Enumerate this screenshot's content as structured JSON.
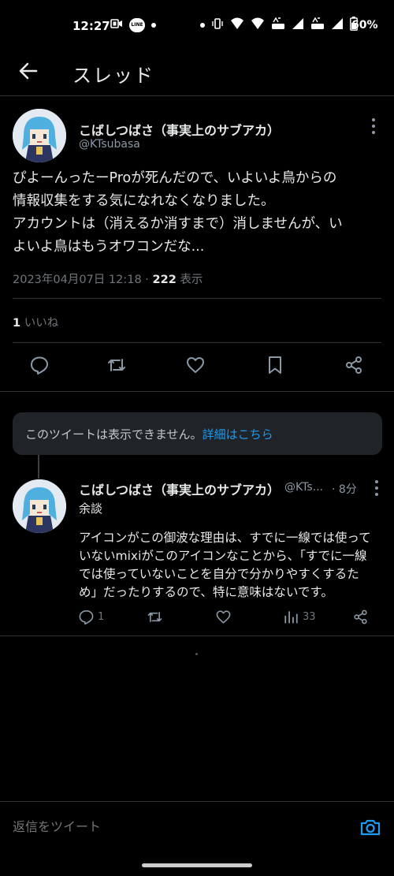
{
  "status_bar": {
    "time": "12:27",
    "battery_text": "60%",
    "line_badge": "LINE",
    "icons": [
      "rec-icon",
      "line-icon",
      "dot-icon",
      "dot-icon",
      "vibrate-icon",
      "wifi-icon",
      "wifi-icon",
      "volte-icon",
      "signal-icon",
      "volte-icon",
      "signal-icon",
      "battery-icon"
    ],
    "battery_level": 0.6
  },
  "header": {
    "title": "スレッド",
    "back_icon": "arrow-left-icon"
  },
  "main_tweet": {
    "name": "こばしつばさ（事実上のサブアカ）",
    "handle": "@KTsubasa",
    "text_lines": [
      "ぴよーんったーProが死んだので、いよいよ鳥からの",
      "情報収集をする気になれなくなりました。",
      "アカウントは（消えるか消すまで）消しませんが、い",
      "よいよ鳥はもうオワコンだな..."
    ],
    "timestamp": "2023年04月07日 12:18 · ",
    "views_count": "222",
    "views_label": " 表示",
    "likes_count": "1",
    "likes_label": " いいね",
    "actions": [
      "reply-icon",
      "retweet-icon",
      "like-icon",
      "bookmark-icon",
      "share-icon"
    ]
  },
  "unavailable_banner": {
    "text": "このツイートは表示できません。",
    "link": "詳細はこちら"
  },
  "reply_tweet": {
    "name": "こばしつばさ（事実上のサブアカ）",
    "handle": "@KTs...",
    "time": "· 8分",
    "subtitle": "余談",
    "text_lines": [
      "アイコンがこの御波な理由は、すでに一線では使って",
      "いないmixiがこのアイコンなことから、「すでに一線",
      "では使っていないことを自分で分かりやすくするた",
      "め」だったりするので、特に意味はないです。"
    ],
    "reply_count": "1",
    "retweet_count": "",
    "like_count": "",
    "views_count": "33"
  },
  "compose": {
    "placeholder": "返信をツイート",
    "camera_icon": "camera-icon"
  },
  "colors": {
    "background": "#000000",
    "text": "#e7e9ea",
    "muted": "#71767b",
    "accent": "#1d9bf0",
    "divider": "#2f3336",
    "banner_bg": "#202327"
  }
}
